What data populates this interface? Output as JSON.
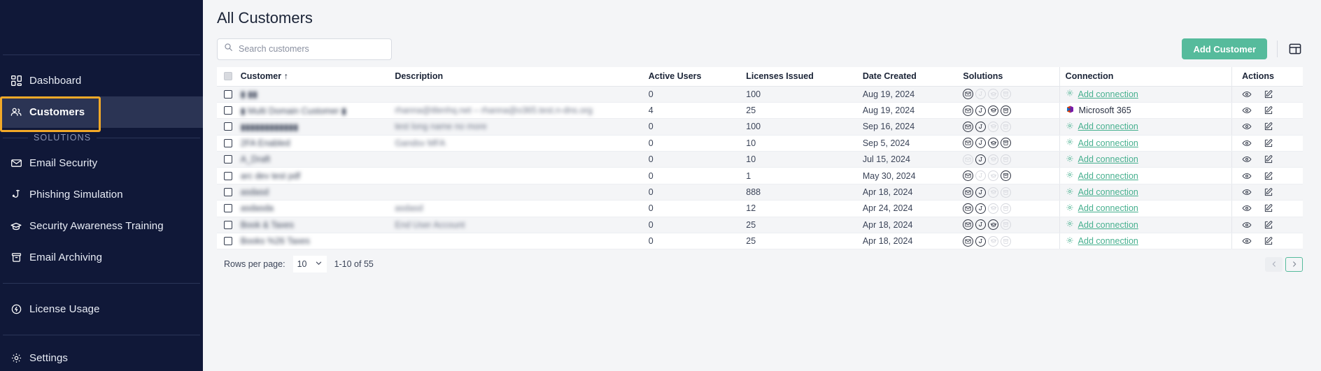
{
  "sidebar": {
    "primary": [
      {
        "label": "Dashboard",
        "icon": "grid-icon",
        "active": false
      },
      {
        "label": "Customers",
        "icon": "users-icon",
        "active": true
      }
    ],
    "section_label": "SOLUTIONS",
    "solutions": [
      {
        "label": "Email Security",
        "icon": "envelope-icon"
      },
      {
        "label": "Phishing Simulation",
        "icon": "fish-hook-icon"
      },
      {
        "label": "Security Awareness Training",
        "icon": "graduation-cap-icon"
      },
      {
        "label": "Email Archiving",
        "icon": "archive-box-icon"
      }
    ],
    "utility": [
      {
        "label": "License Usage",
        "icon": "license-icon"
      },
      {
        "label": "Settings",
        "icon": "gear-icon"
      }
    ]
  },
  "header": {
    "title": "All Customers"
  },
  "search": {
    "value": "",
    "placeholder": "Search customers",
    "icon": "search-icon"
  },
  "toolbar": {
    "add_customer_label": "Add Customer",
    "grid_icon": "table-columns-icon",
    "accent_color": "#56bb9c"
  },
  "table": {
    "columns": [
      "",
      "Customer ↑",
      "Description",
      "Active Users",
      "Licenses Issued",
      "Date Created",
      "Solutions",
      "Connection",
      "Actions"
    ],
    "sort_column": "Customer",
    "sort_direction": "asc",
    "solution_icons": [
      "envelope-icon",
      "fish-hook-icon",
      "graduation-cap-icon",
      "archive-box-icon"
    ],
    "action_icons": [
      "eye-icon",
      "edit-pencil-icon"
    ],
    "add_connection_label": "Add connection",
    "rows": [
      {
        "customer": "▮ ▮▮",
        "description": "",
        "active_users": "0",
        "licenses": "100",
        "date": "Aug 19, 2024",
        "solutions": [
          true,
          false,
          false,
          false
        ],
        "connection": "Add connection",
        "connection_type": "add"
      },
      {
        "customer": "▮ Multi Domain Customer ▮",
        "description": "rhanna@itlenhq.net – rhanna@o365.test.n-dns.org",
        "active_users": "4",
        "licenses": "25",
        "date": "Aug 19, 2024",
        "solutions": [
          true,
          true,
          true,
          true
        ],
        "connection": "Microsoft 365",
        "connection_type": "m365"
      },
      {
        "customer": "▮▮▮▮▮▮▮▮▮▮▮▮",
        "description": "test long name no more",
        "active_users": "0",
        "licenses": "100",
        "date": "Sep 16, 2024",
        "solutions": [
          true,
          true,
          false,
          false
        ],
        "connection": "Add connection",
        "connection_type": "add"
      },
      {
        "customer": "2FA Enabled",
        "description": "Gandsv MFA",
        "active_users": "0",
        "licenses": "10",
        "date": "Sep 5, 2024",
        "solutions": [
          true,
          true,
          true,
          true
        ],
        "connection": "Add connection",
        "connection_type": "add"
      },
      {
        "customer": "A_Draft",
        "description": "",
        "active_users": "0",
        "licenses": "10",
        "date": "Jul 15, 2024",
        "solutions": [
          false,
          true,
          false,
          false
        ],
        "connection": "Add connection",
        "connection_type": "add"
      },
      {
        "customer": "arc dev test pdf",
        "description": "",
        "active_users": "0",
        "licenses": "1",
        "date": "May 30, 2024",
        "solutions": [
          true,
          false,
          false,
          true
        ],
        "connection": "Add connection",
        "connection_type": "add"
      },
      {
        "customer": "asdasd",
        "description": "",
        "active_users": "0",
        "licenses": "888",
        "date": "Apr 18, 2024",
        "solutions": [
          true,
          true,
          false,
          false
        ],
        "connection": "Add connection",
        "connection_type": "add"
      },
      {
        "customer": "asdasda",
        "description": "asdasd",
        "active_users": "0",
        "licenses": "12",
        "date": "Apr 24, 2024",
        "solutions": [
          true,
          true,
          false,
          false
        ],
        "connection": "Add connection",
        "connection_type": "add"
      },
      {
        "customer": "Book & Taxes",
        "description": "End User Account",
        "active_users": "0",
        "licenses": "25",
        "date": "Apr 18, 2024",
        "solutions": [
          true,
          true,
          true,
          false
        ],
        "connection": "Add connection",
        "connection_type": "add"
      },
      {
        "customer": "Books %26 Taxes",
        "description": "",
        "active_users": "0",
        "licenses": "25",
        "date": "Apr 18, 2024",
        "solutions": [
          true,
          true,
          false,
          false
        ],
        "connection": "Add connection",
        "connection_type": "add"
      }
    ]
  },
  "footer": {
    "rows_per_page_label": "Rows per page:",
    "rows_per_page_value": "10",
    "range_label": "1-10 of 55",
    "prev_icon": "chevron-left-icon",
    "next_icon": "chevron-right-icon"
  }
}
